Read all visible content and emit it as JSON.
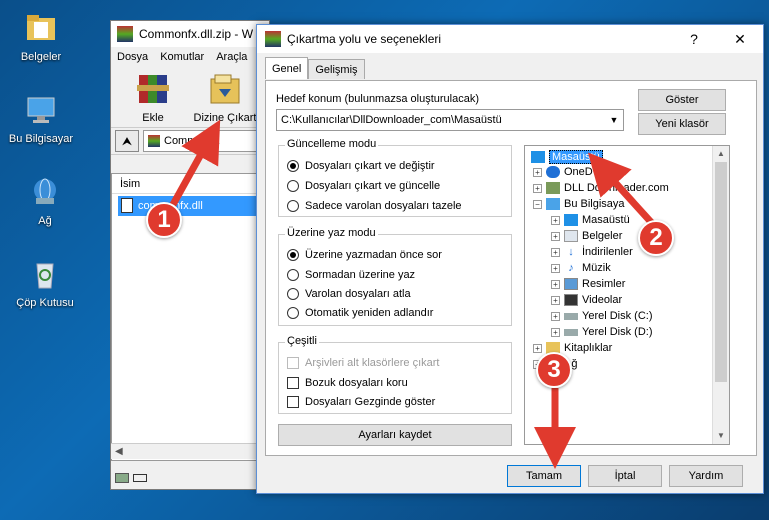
{
  "desktop": {
    "icons": [
      {
        "label": "Belgeler",
        "icon": "folder-icon"
      },
      {
        "label": "Bu Bilgisayar",
        "icon": "computer-icon"
      },
      {
        "label": "Ağ",
        "icon": "network-icon"
      },
      {
        "label": "Çöp Kutusu",
        "icon": "recycle-bin-icon"
      }
    ]
  },
  "winrar": {
    "title": "Commonfx.dll.zip - W",
    "menu": [
      "Dosya",
      "Komutlar",
      "Araçla"
    ],
    "tools": [
      {
        "label": "Ekle",
        "icon": "add-archive-icon"
      },
      {
        "label": "Dizine Çıkart",
        "icon": "extract-to-icon"
      }
    ],
    "address": "Commonfx.",
    "list_header": "İsim",
    "list_item": "commonfx.dll"
  },
  "dialog": {
    "title": "Çıkartma yolu ve seçenekleri",
    "help_btn": "?",
    "close_btn": "✕",
    "tabs": [
      "Genel",
      "Gelişmiş"
    ],
    "dest_label": "Hedef konum (bulunmazsa oluşturulacak)",
    "dest_value": "C:\\Kullanıcılar\\DllDownloader_com\\Masaüstü",
    "show_btn": "Göster",
    "new_folder_btn": "Yeni klasör",
    "update_group": {
      "title": "Güncelleme modu",
      "options": [
        "Dosyaları çıkart ve değiştir",
        "Dosyaları çıkart ve güncelle",
        "Sadece varolan dosyaları tazele"
      ],
      "selected": 0
    },
    "overwrite_group": {
      "title": "Üzerine yaz modu",
      "options": [
        "Üzerine yazmadan önce sor",
        "Sormadan üzerine yaz",
        "Varolan dosyaları atla",
        "Otomatik yeniden adlandır"
      ],
      "selected": 0
    },
    "misc_group": {
      "title": "Çeşitli",
      "options": [
        "Arşivleri alt klasörlere çıkart",
        "Bozuk dosyaları koru",
        "Dosyaları Gezginde göster"
      ]
    },
    "save_btn": "Ayarları kaydet",
    "tree": [
      {
        "label": "Masaüstü",
        "icon": "desktop-icon",
        "level": 0,
        "selected": true
      },
      {
        "label": "OneD",
        "icon": "cloud-icon",
        "level": 1
      },
      {
        "label": "DLL Downloader.com",
        "icon": "user-icon",
        "level": 1
      },
      {
        "label": "Bu Bilgisaya",
        "icon": "computer-icon",
        "level": 1
      },
      {
        "label": "Masaüstü",
        "icon": "desktop-icon",
        "level": 2
      },
      {
        "label": "Belgeler",
        "icon": "documents-icon",
        "level": 2
      },
      {
        "label": "İndirilenler",
        "icon": "download-icon",
        "level": 2
      },
      {
        "label": "Müzik",
        "icon": "music-icon",
        "level": 2
      },
      {
        "label": "Resimler",
        "icon": "pictures-icon",
        "level": 2
      },
      {
        "label": "Videolar",
        "icon": "video-icon",
        "level": 2
      },
      {
        "label": "Yerel Disk (C:)",
        "icon": "drive-icon",
        "level": 2
      },
      {
        "label": "Yerel Disk (D:)",
        "icon": "drive-icon",
        "level": 2
      },
      {
        "label": "Kitaplıklar",
        "icon": "library-icon",
        "level": 1
      },
      {
        "label": "Ağ",
        "icon": "network-icon",
        "level": 1
      }
    ],
    "ok_btn": "Tamam",
    "cancel_btn": "İptal",
    "help_bottom_btn": "Yardım"
  },
  "annotations": [
    "1",
    "2",
    "3"
  ],
  "colors": {
    "arrow": "#e03a2e",
    "selection": "#3399ff"
  }
}
